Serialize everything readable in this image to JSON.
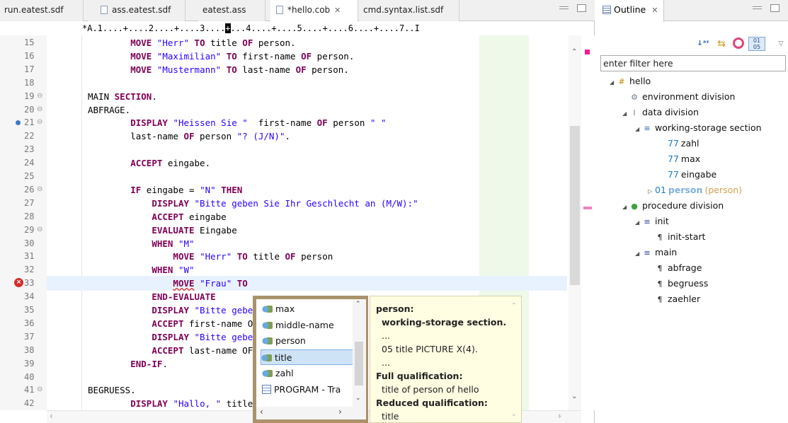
{
  "editor": {
    "tabs": [
      {
        "label": "run.eatest.sdf",
        "icon": "none"
      },
      {
        "label": "ass.eatest.sdf",
        "icon": "file-icon"
      },
      {
        "label": "eatest.ass",
        "icon": "none"
      },
      {
        "label": "*hello.cob",
        "icon": "file-icon",
        "active": true,
        "close": "✕"
      },
      {
        "label": "cmd.syntax.list.sdf",
        "icon": "none"
      }
    ],
    "ruler_left": "*A.1....+....2....+....3....",
    "ruler_cursor": "+",
    "ruler_right": "...4....+....5....+....6....+....7..I"
  },
  "code_lines": [
    {
      "n": "15",
      "fold": "",
      "marker": "",
      "t": [
        [
          "        ",
          ""
        ],
        [
          "MOVE",
          "kw"
        ],
        [
          " ",
          ""
        ],
        [
          "\"Herr\"",
          "str"
        ],
        [
          " ",
          ""
        ],
        [
          "TO",
          "kw"
        ],
        [
          " title ",
          ""
        ],
        [
          "OF",
          "kw"
        ],
        [
          " person.",
          ""
        ]
      ]
    },
    {
      "n": "16",
      "fold": "",
      "marker": "",
      "t": [
        [
          "        ",
          ""
        ],
        [
          "MOVE",
          "kw"
        ],
        [
          " ",
          ""
        ],
        [
          "\"Maximilian\"",
          "str"
        ],
        [
          " ",
          ""
        ],
        [
          "TO",
          "kw"
        ],
        [
          " first-name ",
          ""
        ],
        [
          "OF",
          "kw"
        ],
        [
          " person.",
          ""
        ]
      ]
    },
    {
      "n": "17",
      "fold": "",
      "marker": "",
      "t": [
        [
          "        ",
          ""
        ],
        [
          "MOVE",
          "kw"
        ],
        [
          " ",
          ""
        ],
        [
          "\"Mustermann\"",
          "str"
        ],
        [
          " ",
          ""
        ],
        [
          "TO",
          "kw"
        ],
        [
          " last-name ",
          ""
        ],
        [
          "OF",
          "kw"
        ],
        [
          " person.",
          ""
        ]
      ]
    },
    {
      "n": "18",
      "fold": "",
      "marker": "",
      "t": []
    },
    {
      "n": "19",
      "fold": "⊖",
      "marker": "",
      "t": [
        [
          "MAIN ",
          ""
        ],
        [
          "SECTION",
          "kw"
        ],
        [
          ".",
          ""
        ]
      ]
    },
    {
      "n": "20",
      "fold": "⊖",
      "marker": "",
      "t": [
        [
          "ABFRAGE.",
          ""
        ]
      ]
    },
    {
      "n": "21",
      "fold": "⊖",
      "marker": "bp",
      "t": [
        [
          "        ",
          ""
        ],
        [
          "DISPLAY",
          "kw"
        ],
        [
          " ",
          ""
        ],
        [
          "\"Heissen Sie \"",
          "str"
        ],
        [
          "  first-name ",
          ""
        ],
        [
          "OF",
          "kw"
        ],
        [
          " person ",
          ""
        ],
        [
          "\" \"",
          "str"
        ]
      ]
    },
    {
      "n": "22",
      "fold": "",
      "marker": "",
      "t": [
        [
          "        last-name ",
          ""
        ],
        [
          "OF",
          "kw"
        ],
        [
          " person ",
          ""
        ],
        [
          "\"? (J/N)\"",
          "str"
        ],
        [
          ".",
          ""
        ]
      ]
    },
    {
      "n": "23",
      "fold": "",
      "marker": "",
      "t": []
    },
    {
      "n": "24",
      "fold": "",
      "marker": "",
      "t": [
        [
          "        ",
          ""
        ],
        [
          "ACCEPT",
          "kw"
        ],
        [
          " eingabe.",
          ""
        ]
      ]
    },
    {
      "n": "25",
      "fold": "",
      "marker": "",
      "t": []
    },
    {
      "n": "26",
      "fold": "⊖",
      "marker": "",
      "t": [
        [
          "        ",
          ""
        ],
        [
          "IF",
          "kw"
        ],
        [
          " eingabe = ",
          ""
        ],
        [
          "\"N\"",
          "str"
        ],
        [
          " ",
          ""
        ],
        [
          "THEN",
          "kw"
        ]
      ]
    },
    {
      "n": "27",
      "fold": "",
      "marker": "",
      "t": [
        [
          "            ",
          ""
        ],
        [
          "DISPLAY",
          "kw"
        ],
        [
          " ",
          ""
        ],
        [
          "\"Bitte geben Sie Ihr Geschlecht an (M/W):\"",
          "str"
        ]
      ]
    },
    {
      "n": "28",
      "fold": "",
      "marker": "",
      "t": [
        [
          "            ",
          ""
        ],
        [
          "ACCEPT",
          "kw"
        ],
        [
          " eingabe",
          ""
        ]
      ]
    },
    {
      "n": "29",
      "fold": "⊖",
      "marker": "",
      "t": [
        [
          "            ",
          ""
        ],
        [
          "EVALUATE",
          "kw"
        ],
        [
          " Eingabe",
          ""
        ]
      ]
    },
    {
      "n": "30",
      "fold": "",
      "marker": "",
      "t": [
        [
          "            ",
          ""
        ],
        [
          "WHEN",
          "kw"
        ],
        [
          " ",
          ""
        ],
        [
          "\"M\"",
          "str"
        ]
      ]
    },
    {
      "n": "31",
      "fold": "",
      "marker": "",
      "t": [
        [
          "                ",
          ""
        ],
        [
          "MOVE",
          "kw"
        ],
        [
          " ",
          ""
        ],
        [
          "\"Herr\"",
          "str"
        ],
        [
          " ",
          ""
        ],
        [
          "TO",
          "kw"
        ],
        [
          " title ",
          ""
        ],
        [
          "OF",
          "kw"
        ],
        [
          " person",
          ""
        ]
      ]
    },
    {
      "n": "32",
      "fold": "",
      "marker": "",
      "t": [
        [
          "            ",
          ""
        ],
        [
          "WHEN",
          "kw"
        ],
        [
          " ",
          ""
        ],
        [
          "\"W\"",
          "str"
        ]
      ]
    },
    {
      "n": "33",
      "fold": "",
      "marker": "err",
      "hl": true,
      "t": [
        [
          "                ",
          ""
        ],
        [
          "MOVE",
          "kw"
        ],
        [
          " ",
          ""
        ],
        [
          "\"Frau\"",
          "str"
        ],
        [
          " ",
          ""
        ],
        [
          "TO",
          "kw"
        ]
      ]
    },
    {
      "n": "34",
      "fold": "",
      "marker": "",
      "t": [
        [
          "            ",
          ""
        ],
        [
          "END-EVALUATE",
          "kw"
        ]
      ]
    },
    {
      "n": "35",
      "fold": "",
      "marker": "",
      "t": [
        [
          "            ",
          ""
        ],
        [
          "DISPLAY",
          "kw"
        ],
        [
          " ",
          ""
        ],
        [
          "\"Bitte gebe",
          "str"
        ]
      ]
    },
    {
      "n": "36",
      "fold": "",
      "marker": "",
      "t": [
        [
          "            ",
          ""
        ],
        [
          "ACCEPT",
          "kw"
        ],
        [
          " first-name O",
          ""
        ]
      ]
    },
    {
      "n": "37",
      "fold": "",
      "marker": "",
      "t": [
        [
          "            ",
          ""
        ],
        [
          "DISPLAY",
          "kw"
        ],
        [
          " ",
          ""
        ],
        [
          "\"Bitte gebe",
          "str"
        ]
      ]
    },
    {
      "n": "38",
      "fold": "",
      "marker": "",
      "t": [
        [
          "            ",
          ""
        ],
        [
          "ACCEPT",
          "kw"
        ],
        [
          " last-name OF",
          ""
        ]
      ]
    },
    {
      "n": "39",
      "fold": "",
      "marker": "",
      "t": [
        [
          "        ",
          ""
        ],
        [
          "END-IF",
          "kw"
        ],
        [
          ".",
          ""
        ]
      ]
    },
    {
      "n": "40",
      "fold": "",
      "marker": "",
      "t": []
    },
    {
      "n": "41",
      "fold": "⊖",
      "marker": "",
      "t": [
        [
          "BEGRUESS.",
          ""
        ]
      ]
    },
    {
      "n": "42",
      "fold": "",
      "marker": "",
      "t": [
        [
          "        ",
          ""
        ],
        [
          "DISPLAY",
          "kw"
        ],
        [
          " ",
          ""
        ],
        [
          "\"Hallo, \"",
          "str"
        ],
        [
          " title",
          ""
        ]
      ]
    }
  ],
  "assist": {
    "items": [
      {
        "label": "max",
        "icon": "field"
      },
      {
        "label": "middle-name",
        "icon": "field"
      },
      {
        "label": "person",
        "icon": "field"
      },
      {
        "label": "title",
        "icon": "field",
        "selected": true
      },
      {
        "label": "zahl",
        "icon": "field"
      },
      {
        "label": "PROGRAM - Tra",
        "icon": "prog"
      }
    ],
    "doc": {
      "h1": "person:",
      "l1": "working-storage section.",
      "l2": "...",
      "l3": "05 title PICTURE X(4).",
      "l4": "...",
      "h2": "Full qualification:",
      "l5": "title of person of hello",
      "h3": "Reduced qualification:",
      "l6": "title"
    }
  },
  "outline": {
    "tab_label": "Outline",
    "tab_close": "✕",
    "filter_placeholder": "enter filter here",
    "tree": [
      {
        "label": "hello",
        "extra": "",
        "depth": 0,
        "twist": "◢",
        "icon": "#",
        "icon_color": "#c28a00",
        "name": "program-node"
      },
      {
        "label": "environment division",
        "extra": "",
        "depth": 1,
        "twist": "",
        "icon": "⚙",
        "icon_color": "#6a7a90",
        "name": "environment-division-node"
      },
      {
        "label": "data division",
        "extra": "",
        "depth": 1,
        "twist": "◢",
        "icon": "⁞",
        "icon_color": "#555",
        "name": "data-division-node"
      },
      {
        "label": "working-storage section",
        "extra": "",
        "depth": 2,
        "twist": "◢",
        "icon": "≡",
        "icon_color": "#2e6fb8",
        "name": "working-storage-node"
      },
      {
        "label": "zahl",
        "level": "77",
        "extra": "",
        "depth": 4,
        "twist": "",
        "icon": "",
        "name": "zahl-node"
      },
      {
        "label": "max",
        "level": "77",
        "extra": "",
        "depth": 4,
        "twist": "",
        "icon": "",
        "name": "max-node"
      },
      {
        "label": "eingabe",
        "level": "77",
        "extra": "",
        "depth": 4,
        "twist": "",
        "icon": "",
        "name": "eingabe-node"
      },
      {
        "label": "person",
        "level": "01",
        "extra": "(person)",
        "depth": 3,
        "twist": "▷",
        "icon": "",
        "name": "person-node",
        "faded": true
      },
      {
        "label": "procedure division",
        "extra": "",
        "depth": 1,
        "twist": "◢",
        "icon": "●",
        "icon_color": "#3fa33f",
        "name": "procedure-division-node"
      },
      {
        "label": "init",
        "extra": "",
        "depth": 2,
        "twist": "◢",
        "icon": "≡",
        "icon_color": "#2e3f9e",
        "name": "init-node"
      },
      {
        "label": "init-start",
        "extra": "",
        "depth": 3,
        "twist": "",
        "icon": "¶",
        "icon_color": "#333",
        "name": "init-start-node"
      },
      {
        "label": "main",
        "extra": "",
        "depth": 2,
        "twist": "◢",
        "icon": "≡",
        "icon_color": "#2e3f9e",
        "name": "main-node"
      },
      {
        "label": "abfrage",
        "extra": "",
        "depth": 3,
        "twist": "",
        "icon": "¶",
        "icon_color": "#333",
        "name": "abfrage-node"
      },
      {
        "label": "begruess",
        "extra": "",
        "depth": 3,
        "twist": "",
        "icon": "¶",
        "icon_color": "#333",
        "name": "begruess-node"
      },
      {
        "label": "zaehler",
        "extra": "",
        "depth": 3,
        "twist": "",
        "icon": "¶",
        "icon_color": "#333",
        "name": "zaehler-node"
      }
    ]
  }
}
